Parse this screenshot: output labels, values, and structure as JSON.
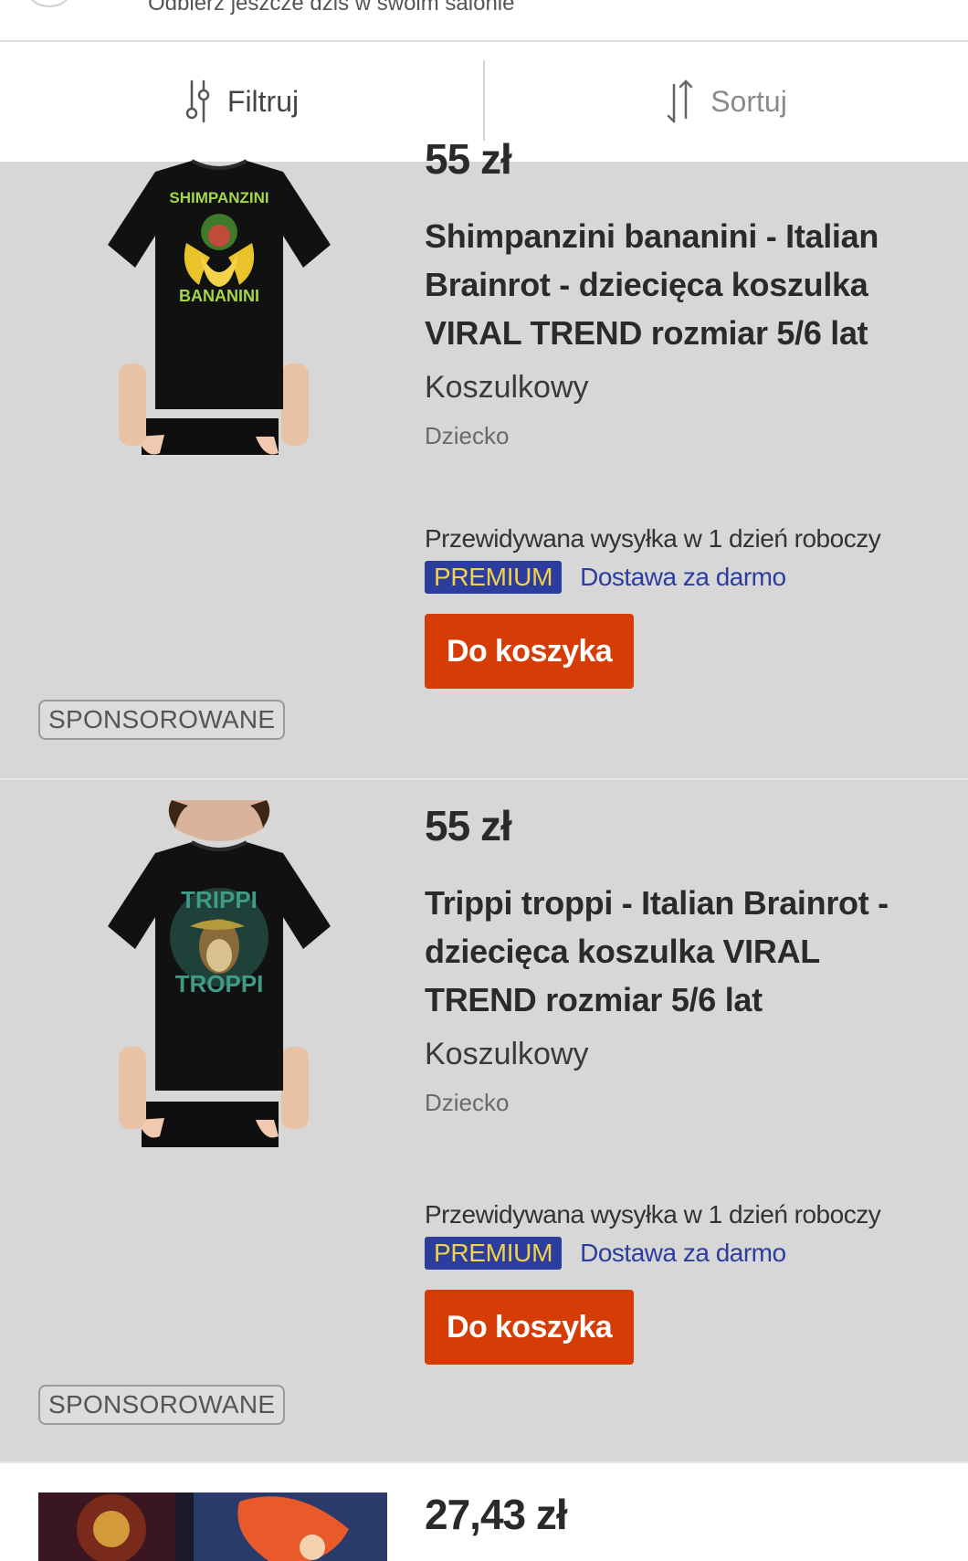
{
  "top_banner": {
    "text": "Odbierz jeszcze dziś w swoim salonie"
  },
  "toolbar": {
    "filter_label": "Filtruj",
    "sort_label": "Sortuj"
  },
  "products": [
    {
      "price": "55 zł",
      "title": "Shimpanzini bananini - Italian Brainrot - dziecięca koszulka VIRAL TREND rozmiar 5/6 lat",
      "brand": "Koszulkowy",
      "category": "Dziecko",
      "shipping": "Przewidywana wysyłka w 1 dzień roboczy",
      "premium": "PREMIUM",
      "free_delivery": "Dostawa za darmo",
      "cart_button": "Do koszyka",
      "sponsored": "SPONSOROWANE",
      "shirt_print_top": "SHIMPANZINI",
      "shirt_print_bottom": "BANANINI",
      "print_color": "#a6d64a"
    },
    {
      "price": "55 zł",
      "title": "Trippi troppi - Italian Brainrot - dziecięca koszulka VIRAL TREND rozmiar 5/6 lat",
      "brand": "Koszulkowy",
      "category": "Dziecko",
      "shipping": "Przewidywana wysyłka w 1 dzień roboczy",
      "premium": "PREMIUM",
      "free_delivery": "Dostawa za darmo",
      "cart_button": "Do koszyka",
      "sponsored": "SPONSOROWANE",
      "shirt_print_top": "TRIPPI",
      "shirt_print_bottom": "TROPPI",
      "print_color": "#3f9a86"
    },
    {
      "price": "27,43 zł"
    }
  ],
  "colors": {
    "cart_button": "#d63c05",
    "premium_bg": "#2c3d9e",
    "premium_text": "#f2d24a",
    "free_delivery": "#2c3d9e",
    "card_bg": "#d7d7d7"
  }
}
